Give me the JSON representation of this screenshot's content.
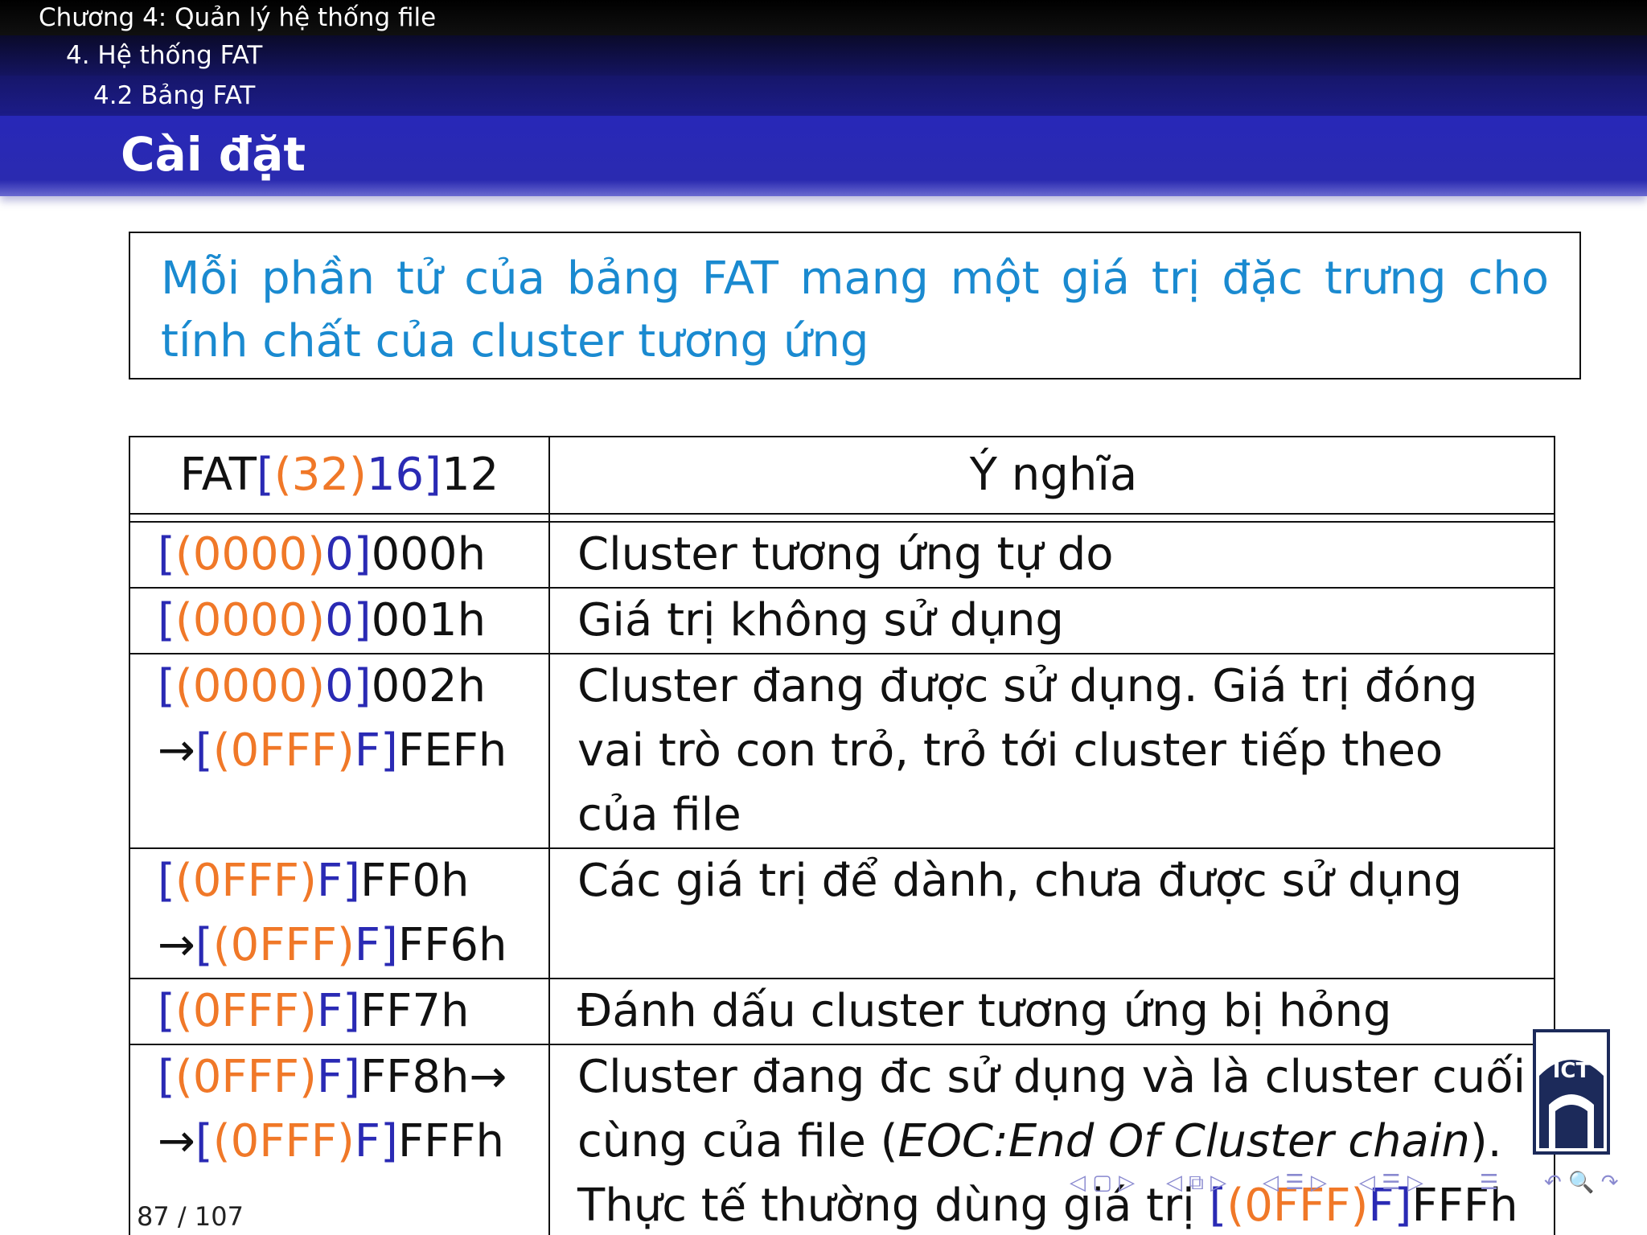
{
  "header": {
    "chapter": "Chương 4: Quản lý hệ thống file",
    "section": "4. Hệ thống FAT",
    "subsection": "4.2 Bảng FAT"
  },
  "slide": {
    "title": "Cài đặt",
    "definition": "Mỗi phần tử của bảng FAT mang một giá trị đặc trưng cho tính chất của cluster tương ứng"
  },
  "table": {
    "headers": [
      "FAT[(32)16]12",
      "Ý nghĩa"
    ],
    "rows": [
      {
        "value": "[(0000)0]000h",
        "meaning": "Cluster tương ứng tự do"
      },
      {
        "value": "[(0000)0]001h",
        "meaning": "Giá trị không sử dụng"
      },
      {
        "value": "[(0000)0]002h →[(0FFF)F]FEFh",
        "meaning": "Cluster đang được sử dụng. Giá trị đóng vai trò con trỏ, trỏ tới cluster tiếp theo của file"
      },
      {
        "value": "[(0FFF)F]FF0h →[(0FFF)F]FF6h",
        "meaning": "Các giá trị để dành, chưa được sử dụng"
      },
      {
        "value": "[(0FFF)F]FF7h",
        "meaning": "Đánh dấu cluster tương ứng bị hỏng"
      },
      {
        "value": "[(0FFF)F]FF8h→ →[(0FFF)F]FFFh",
        "meaning": "Cluster đang đc sử dụng và là cluster cuối cùng của file (EOC:End Of Cluster chain). Thực tế thường dùng giá trị [(0FFF)F]FFFh"
      }
    ]
  },
  "footer": {
    "page": "87",
    "separator": "/",
    "total": "107"
  },
  "logo": {
    "text": "ICT"
  },
  "colors": {
    "header_bg": "#000000",
    "title_bg": "#2a2ab0",
    "definition_text": "#1a8ad0",
    "bracket_blue": "#2a2ab4",
    "bracket_orange": "#f07828"
  }
}
